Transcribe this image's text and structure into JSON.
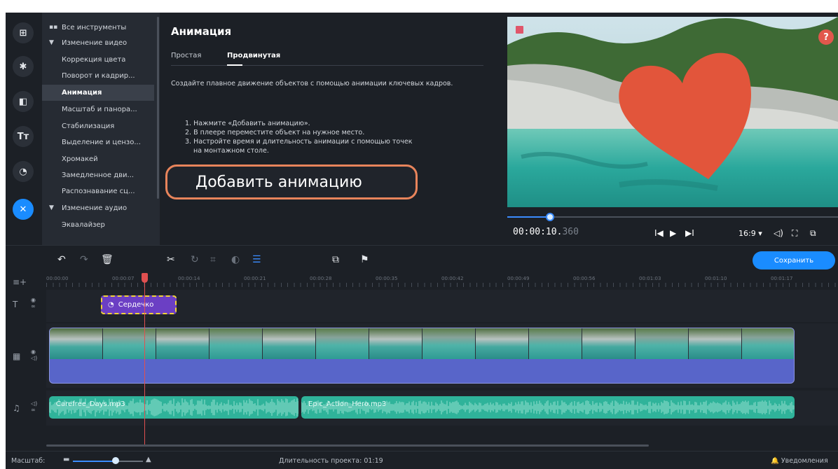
{
  "sidebar_icons": [
    {
      "name": "import-icon",
      "glyph": "⊞"
    },
    {
      "name": "magic-icon",
      "glyph": "✱"
    },
    {
      "name": "transitions-icon",
      "glyph": "◧"
    },
    {
      "name": "titles-icon",
      "glyph": "Tт"
    },
    {
      "name": "stickers-icon",
      "glyph": "◔"
    },
    {
      "name": "tools-icon",
      "glyph": "✕"
    }
  ],
  "tools": {
    "all_tools": "Все инструменты",
    "video_group": "Изменение видео",
    "items": [
      "Коррекция цвета",
      "Поворот и кадрир...",
      "Анимация",
      "Масштаб и панора...",
      "Стабилизация",
      "Выделение и цензо...",
      "Хромакей",
      "Замедленное дви...",
      "Распознавание сц..."
    ],
    "audio_group": "Изменение аудио",
    "audio_items": [
      "Эквалайзер"
    ]
  },
  "panel": {
    "title": "Анимация",
    "tabs": [
      "Простая",
      "Продвинутая"
    ],
    "description": "Создайте плавное движение объектов с помощью анимации ключевых кадров.",
    "steps": [
      "1. Нажмите «Добавить анимацию».",
      "2. В плеере переместите объект на нужное место.",
      "3. Настройте время и длительность анимации с помощью точек",
      "    на монтажном столе."
    ],
    "add_button": "Добавить анимацию"
  },
  "player": {
    "timecode_main": "00:00:10.",
    "timecode_ms": "360",
    "aspect": "16:9 ▾",
    "help": "?",
    "progress": 0.13
  },
  "timeline": {
    "save_label": "Сохранить",
    "ruler": [
      "00:00:00",
      "00:00:07",
      "00:00:14",
      "00:00:21",
      "00:00:28",
      "00:00:35",
      "00:00:42",
      "00:00:49",
      "00:00:56",
      "00:01:03",
      "00:01:10",
      "00:01:17"
    ],
    "text_clip": "Сердечко",
    "audio_a": "Carefree_Days.mp3",
    "audio_b": "Epic_Action_Hero.mp3"
  },
  "status": {
    "zoom_label": "Масштаб:",
    "duration": "Длительность проекта: 01:19",
    "notifications": "Уведомления"
  },
  "colors": {
    "accent": "#1a8cff",
    "heart": "#e2553b",
    "highlight": "#e8845b",
    "audio": "#2fb39a",
    "video_track": "#5865c9",
    "text_clip": "#6b3fc4"
  }
}
